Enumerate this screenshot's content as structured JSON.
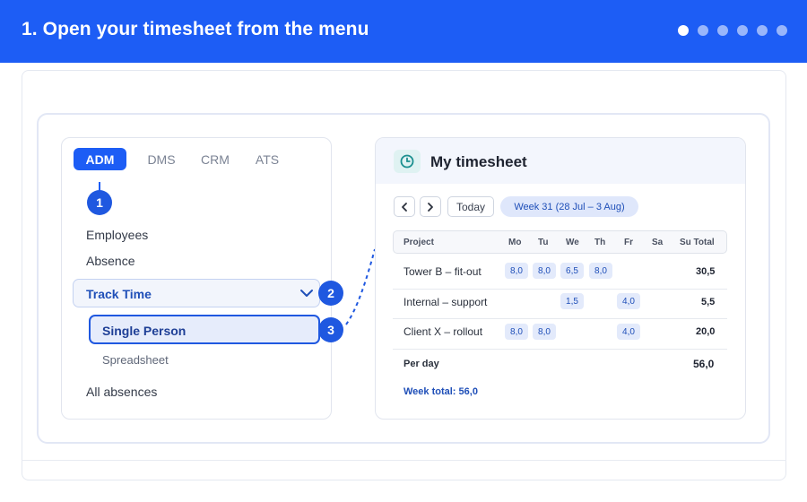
{
  "header": {
    "step_title": "1. Open your timesheet from the menu",
    "dots": [
      true,
      false,
      false,
      false,
      false,
      false
    ],
    "accent": "#1d5df5"
  },
  "menu": {
    "modules": [
      "ADM",
      "DMS",
      "CRM",
      "ATS"
    ],
    "active_module": "ADM",
    "badges": [
      "1",
      "2",
      "3"
    ],
    "items": {
      "employees": "Employees",
      "absence": "Absence",
      "track_time": "Track Time",
      "single_person": "Single Person",
      "spreadsheet": "Spreadsheet",
      "all_absences": "All absences"
    },
    "icons": {
      "clock": "clock-icon",
      "chevron": "chevron-down-icon"
    }
  },
  "timesheet": {
    "title": "My timesheet",
    "today_label": "Today",
    "week_label": "Week 31 (28 Jul – 3 Aug)",
    "columns": [
      "Project",
      "Mo",
      "Tu",
      "We",
      "Th",
      "Fr",
      "Sa",
      "Su Total"
    ],
    "rows": [
      {
        "project": "Tower B – fit-out",
        "mo": "8,0",
        "tu": "8,0",
        "we": "6,5",
        "th": "8,0",
        "fr": "",
        "total": "30,5"
      },
      {
        "project": "Internal – support",
        "mo": "",
        "tu": "",
        "we": "1,5",
        "th": "",
        "fr": "4,0",
        "total": "5,5"
      },
      {
        "project": "Client X – rollout",
        "mo": "8,0",
        "tu": "8,0",
        "we": "",
        "th": "",
        "fr": "4,0",
        "total": "20,0"
      }
    ],
    "per_day_label": "Per day",
    "per_day_total": "56,0",
    "week_total": "Week total: 56,0"
  }
}
